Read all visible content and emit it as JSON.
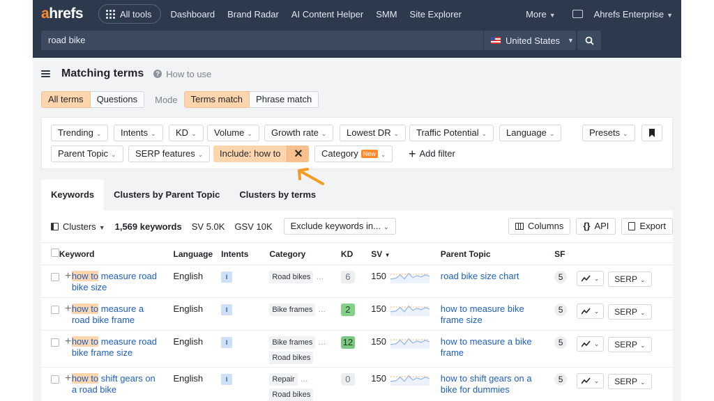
{
  "nav": {
    "logo_accent": "a",
    "logo_rest": "hrefs",
    "all_tools": "All tools",
    "links": [
      "Dashboard",
      "Brand Radar",
      "AI Content Helper",
      "SMM",
      "Site Explorer"
    ],
    "more": "More",
    "account": "Ahrefs Enterprise"
  },
  "search": {
    "query": "road bike",
    "country": "United States"
  },
  "page": {
    "title": "Matching terms",
    "how_to_use": "How to use"
  },
  "segments": {
    "scope": [
      "All terms",
      "Questions"
    ],
    "mode_label": "Mode",
    "modes": [
      "Terms match",
      "Phrase match"
    ]
  },
  "filters": {
    "row1": [
      "Trending",
      "Intents",
      "KD",
      "Volume",
      "Growth rate",
      "Lowest DR",
      "Traffic Potential",
      "Language"
    ],
    "presets": "Presets",
    "parent_topic": "Parent Topic",
    "serp_features": "SERP features",
    "include": "Include: how to",
    "category": "Category",
    "new_badge": "New",
    "add_filter": "Add filter"
  },
  "tabs": [
    "Keywords",
    "Clusters by Parent Topic",
    "Clusters by terms"
  ],
  "toolbar": {
    "clusters": "Clusters",
    "keywords_count": "1,569 keywords",
    "sv": "SV 5.0K",
    "gsv": "GSV 10K",
    "exclude": "Exclude keywords in...",
    "columns": "Columns",
    "api": "API",
    "export": "Export"
  },
  "table": {
    "headers": {
      "keyword": "Keyword",
      "language": "Language",
      "intents": "Intents",
      "category": "Category",
      "kd": "KD",
      "sv": "SV",
      "parent_topic": "Parent Topic",
      "sf": "SF"
    },
    "rows": [
      {
        "hl": "how to",
        "rest": " measure road bike size",
        "language": "English",
        "intent": "I",
        "cats": [
          "Road bikes"
        ],
        "kd": "6",
        "sv": "150",
        "parent": "road bike size chart",
        "sf": "5",
        "serp": "SERP"
      },
      {
        "hl": "how to",
        "rest": " measure a road bike frame",
        "language": "English",
        "intent": "I",
        "cats": [
          "Bike frames"
        ],
        "kd": "2",
        "sv": "150",
        "parent": "how to measure bike frame size",
        "sf": "5",
        "serp": "SERP"
      },
      {
        "hl": "how to",
        "rest": " measure road bike frame size",
        "language": "English",
        "intent": "I",
        "cats": [
          "Bike frames",
          "Road bikes"
        ],
        "kd": "12",
        "sv": "150",
        "parent": "how to measure a bike frame",
        "sf": "5",
        "serp": "SERP"
      },
      {
        "hl": "how to",
        "rest": " shift gears on a road bike",
        "language": "English",
        "intent": "I",
        "cats": [
          "Repair",
          "Road bikes"
        ],
        "kd": "0",
        "sv": "150",
        "parent": "how to shift gears on a bike for dummies",
        "sf": "5",
        "serp": "SERP"
      }
    ]
  },
  "colors": {
    "nav_bg": "#2d3a4e",
    "accent_orange": "#ff8a2b",
    "highlight": "#ffd5ad",
    "link_blue": "#1d5fbf"
  }
}
